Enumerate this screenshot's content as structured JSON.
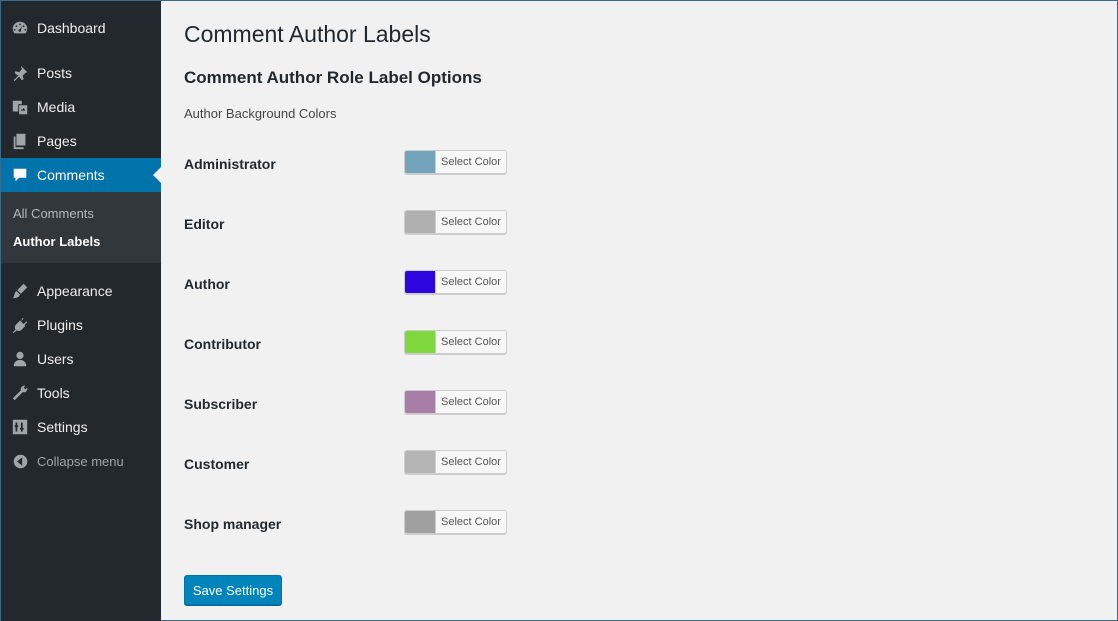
{
  "sidebar": {
    "items": [
      {
        "label": "Dashboard",
        "icon": "dashboard-icon"
      },
      {
        "label": "Posts",
        "icon": "pin-icon"
      },
      {
        "label": "Media",
        "icon": "media-icon"
      },
      {
        "label": "Pages",
        "icon": "pages-icon"
      },
      {
        "label": "Comments",
        "icon": "comment-icon"
      },
      {
        "label": "Appearance",
        "icon": "brush-icon"
      },
      {
        "label": "Plugins",
        "icon": "plugin-icon"
      },
      {
        "label": "Users",
        "icon": "user-icon"
      },
      {
        "label": "Tools",
        "icon": "wrench-icon"
      },
      {
        "label": "Settings",
        "icon": "sliders-icon"
      }
    ],
    "submenu": [
      "All Comments",
      "Author Labels"
    ],
    "collapse_label": "Collapse menu",
    "active_item": "Comments",
    "active_sub": "Author Labels"
  },
  "page": {
    "title": "Comment Author Labels",
    "section_title": "Comment Author Role Label Options",
    "section_desc": "Author Background Colors"
  },
  "roles": [
    {
      "label": "Administrator",
      "color": "#72a5bb",
      "button": "Select Color"
    },
    {
      "label": "Editor",
      "color": "#b0b0b0",
      "button": "Select Color"
    },
    {
      "label": "Author",
      "color": "#2e07e0",
      "button": "Select Color"
    },
    {
      "label": "Contributor",
      "color": "#7ed83e",
      "button": "Select Color"
    },
    {
      "label": "Subscriber",
      "color": "#a87ea8",
      "button": "Select Color"
    },
    {
      "label": "Customer",
      "color": "#b5b5b5",
      "button": "Select Color"
    },
    {
      "label": "Shop manager",
      "color": "#a0a0a0",
      "button": "Select Color"
    }
  ],
  "save_label": "Save Settings",
  "colors": {
    "sidebar_bg": "#23282d",
    "active_bg": "#0073aa",
    "button_primary": "#0085ba"
  }
}
